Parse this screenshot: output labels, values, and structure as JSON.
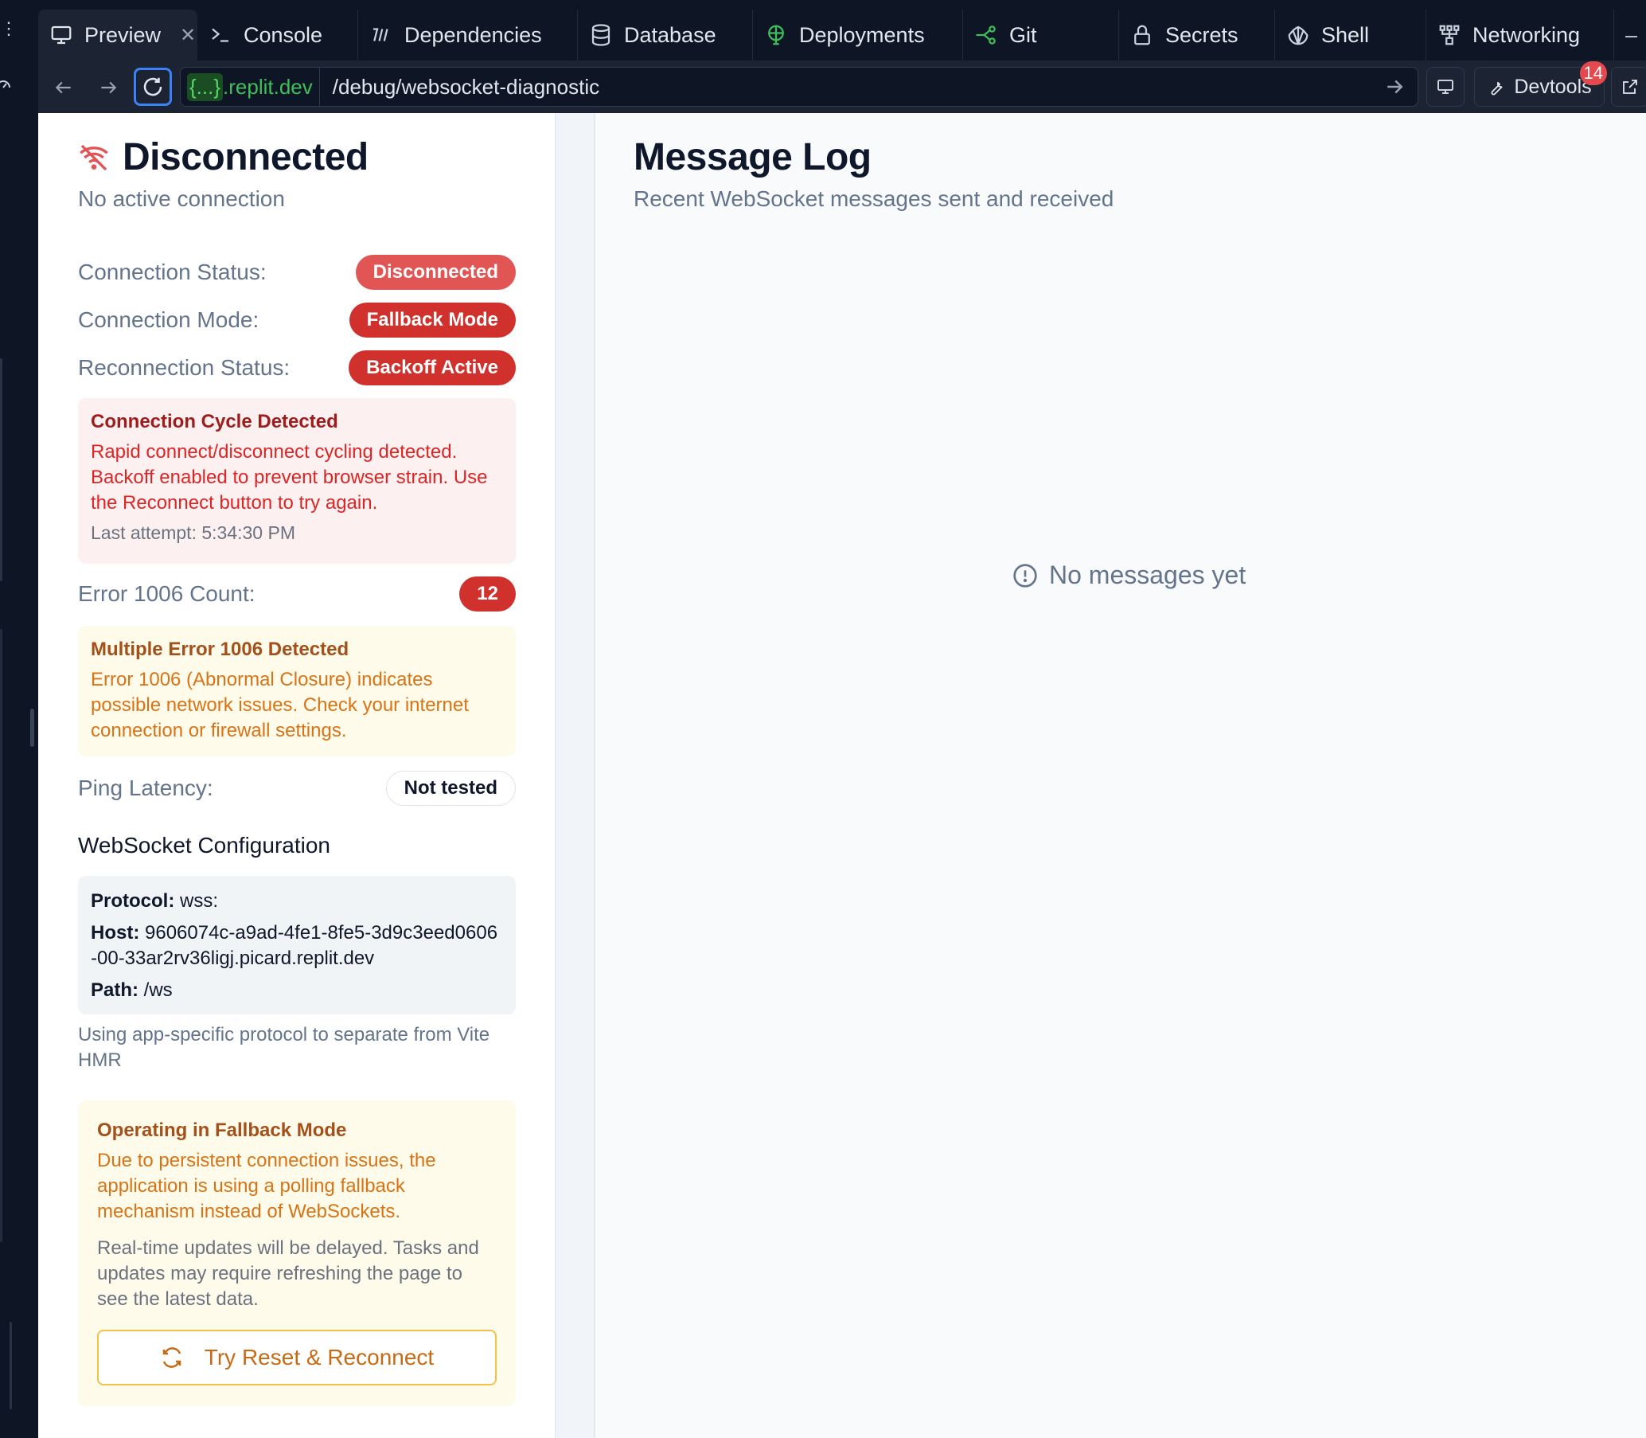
{
  "tabs": [
    {
      "label": "Preview",
      "icon": "monitor-icon",
      "active": true
    },
    {
      "label": "Console",
      "icon": "terminal-icon"
    },
    {
      "label": "Dependencies",
      "icon": "dependencies-icon"
    },
    {
      "label": "Database",
      "icon": "database-icon"
    },
    {
      "label": "Deployments",
      "icon": "deployments-icon"
    },
    {
      "label": "Git",
      "icon": "git-icon"
    },
    {
      "label": "Secrets",
      "icon": "lock-icon"
    },
    {
      "label": "Shell",
      "icon": "shell-icon"
    },
    {
      "label": "Networking",
      "icon": "networking-icon"
    }
  ],
  "url": {
    "domain_chip": "{...}",
    "domain": ".replit.dev",
    "path": "/debug/websocket-diagnostic"
  },
  "devtools": {
    "label": "Devtools",
    "badge": "14"
  },
  "status": {
    "title": "Disconnected",
    "subtitle": "No active connection",
    "connection_status_label": "Connection Status:",
    "connection_status_value": "Disconnected",
    "connection_mode_label": "Connection Mode:",
    "connection_mode_value": "Fallback Mode",
    "reconnection_status_label": "Reconnection Status:",
    "reconnection_status_value": "Backoff Active"
  },
  "cycle_alert": {
    "title": "Connection Cycle Detected",
    "body": "Rapid connect/disconnect cycling detected. Backoff enabled to prevent browser strain. Use the Reconnect button to try again.",
    "last_attempt": "Last attempt: 5:34:30 PM"
  },
  "error_count": {
    "label": "Error 1006 Count:",
    "value": "12"
  },
  "error_alert": {
    "title": "Multiple Error 1006 Detected",
    "body": "Error 1006 (Abnormal Closure) indicates possible network issues. Check your internet connection or firewall settings."
  },
  "ping": {
    "label": "Ping Latency:",
    "value": "Not tested"
  },
  "config": {
    "heading": "WebSocket Configuration",
    "protocol_label": "Protocol:",
    "protocol_value": " wss:",
    "host_label": "Host:",
    "host_value": " 9606074c-a9ad-4fe1-8fe5-3d9c3eed0606-00-33ar2rv36ligj.picard.replit.dev",
    "path_label": "Path:",
    "path_value": " /ws",
    "note": "Using app-specific protocol to separate from Vite HMR"
  },
  "fallback": {
    "title": "Operating in Fallback Mode",
    "body": "Due to persistent connection issues, the application is using a polling fallback mechanism instead of WebSockets.",
    "body2": "Real-time updates will be delayed. Tasks and updates may require refreshing the page to see the latest data.",
    "button": "Try Reset & Reconnect"
  },
  "message_log": {
    "title": "Message Log",
    "subtitle": "Recent WebSocket messages sent and received",
    "empty": "No messages yet"
  },
  "colors": {
    "accent_blue": "#3b82f6",
    "danger": "#d0312d",
    "warning": "#d97316",
    "domain_green": "#3fbf5a"
  }
}
